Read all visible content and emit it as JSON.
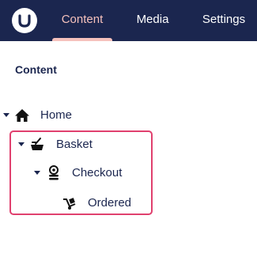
{
  "header": {
    "tabs": [
      {
        "label": "Content",
        "active": true
      },
      {
        "label": "Media",
        "active": false
      },
      {
        "label": "Settings",
        "active": false
      }
    ],
    "logo_icon": "umbraco-logo",
    "background_color": "#1b264f",
    "active_tab_color": "#f5c1bc"
  },
  "sidebar": {
    "title": "Content",
    "tree": [
      {
        "label": "Home",
        "icon": "home-icon",
        "expanded": true,
        "level": 0
      },
      {
        "label": "Basket",
        "icon": "basket-icon",
        "expanded": true,
        "level": 1
      },
      {
        "label": "Checkout",
        "icon": "coins-icon",
        "expanded": true,
        "level": 2
      },
      {
        "label": "Ordered",
        "icon": "delivery-icon",
        "expanded": false,
        "level": 3
      }
    ],
    "highlight_color": "#e0406e"
  }
}
